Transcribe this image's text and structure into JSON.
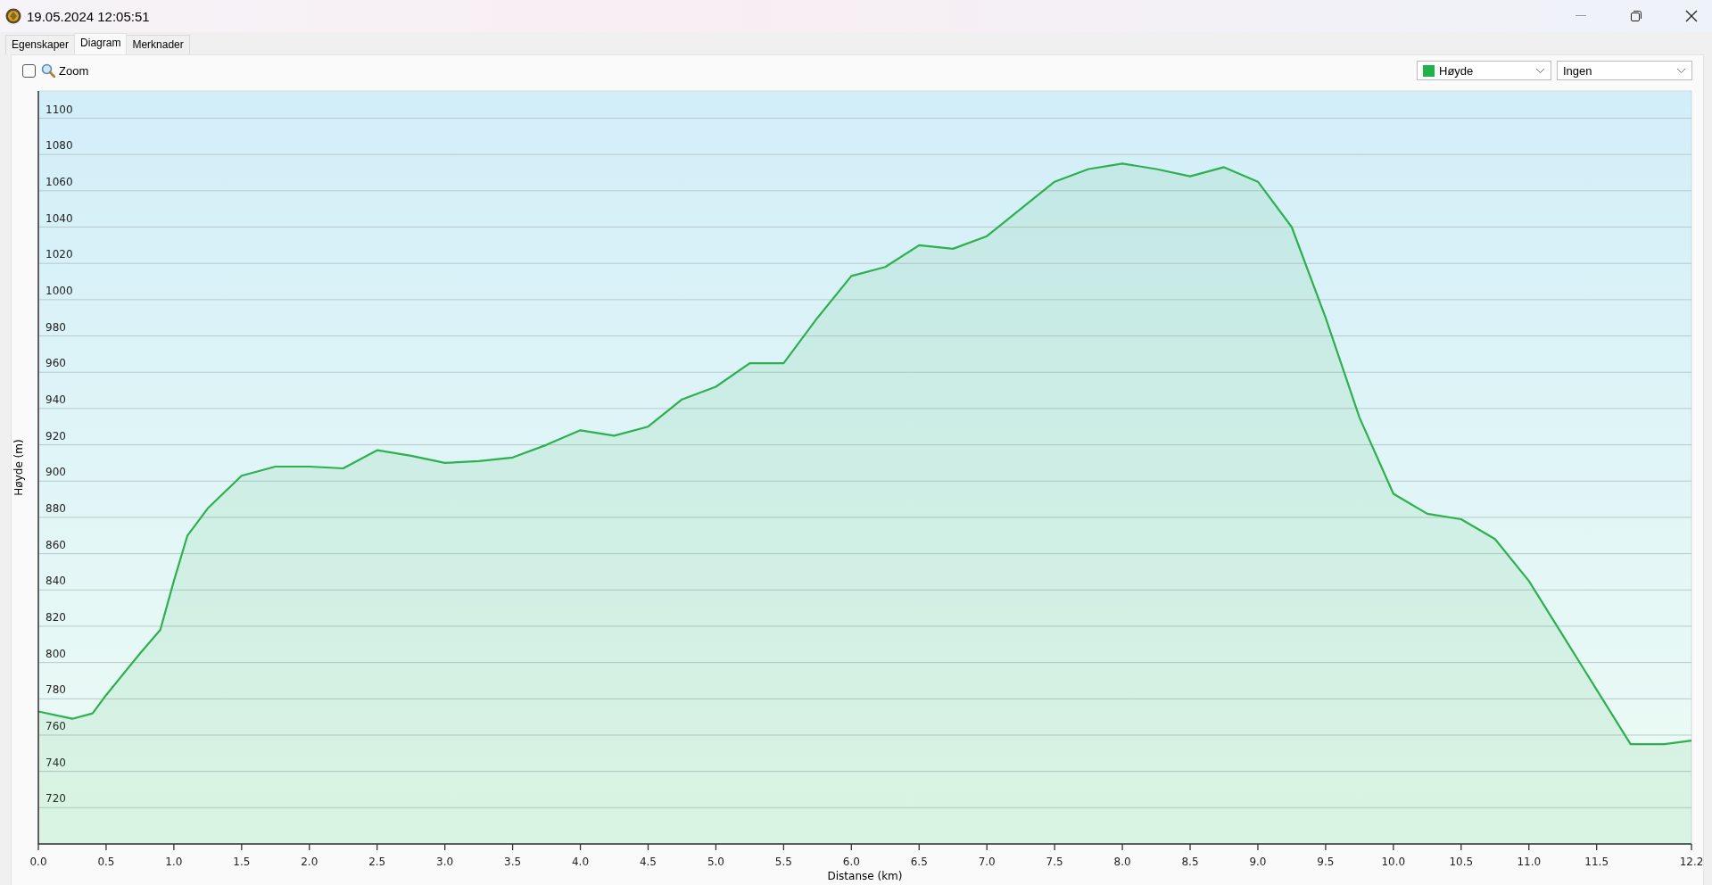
{
  "window": {
    "title": "19.05.2024 12:05:51"
  },
  "tabs": [
    {
      "label": "Egenskaper",
      "selected": false
    },
    {
      "label": "Diagram",
      "selected": true
    },
    {
      "label": "Merknader",
      "selected": false
    }
  ],
  "toolbar": {
    "zoom": {
      "label": "Zoom",
      "checked": false
    },
    "series_select": {
      "color": "#22b14c"
    },
    "secondary_select": {
      "value": "Ingen"
    }
  },
  "chart": {
    "chart_data": {
      "type": "area",
      "xlabel": "Distanse (km)",
      "ylabel": "Høyde (m)",
      "x": [
        0,
        0.25,
        0.4,
        0.5,
        0.75,
        0.9,
        1.0,
        1.1,
        1.25,
        1.5,
        1.75,
        2.0,
        2.25,
        2.5,
        2.75,
        3.0,
        3.25,
        3.5,
        3.75,
        4.0,
        4.25,
        4.5,
        4.75,
        5.0,
        5.25,
        5.5,
        5.75,
        6.0,
        6.25,
        6.5,
        6.75,
        7.0,
        7.25,
        7.5,
        7.75,
        8.0,
        8.25,
        8.5,
        8.75,
        9.0,
        9.25,
        9.5,
        9.75,
        10.0,
        10.25,
        10.5,
        10.75,
        11.0,
        11.25,
        11.5,
        11.75,
        12.0,
        12.2
      ],
      "series": [
        {
          "name": "Høyde",
          "color": "#2db14f",
          "values": [
            773,
            769,
            772,
            782,
            805,
            818,
            845,
            870,
            885,
            903,
            908,
            908,
            907,
            917,
            914,
            910,
            911,
            913,
            920,
            928,
            925,
            930,
            945,
            952,
            965,
            965,
            990,
            1013,
            1018,
            1030,
            1028,
            1035,
            1050,
            1065,
            1072,
            1075,
            1072,
            1068,
            1073,
            1065,
            1040,
            990,
            935,
            893,
            882,
            879,
            868,
            845,
            815,
            785,
            755,
            755,
            757
          ]
        }
      ],
      "grid": true,
      "xlim": [
        0,
        12.2
      ],
      "ylim": [
        700,
        1115
      ],
      "xticks": [
        {
          "value": 0,
          "label": "0.0"
        },
        0.5,
        {
          "value": 1,
          "label": "1.0"
        },
        1.5,
        {
          "value": 2,
          "label": "2.0"
        },
        2.5,
        {
          "value": 3,
          "label": "3.0"
        },
        3.5,
        {
          "value": 4,
          "label": "4.0"
        },
        4.5,
        {
          "value": 5,
          "label": "5.0"
        },
        5.5,
        {
          "value": 6,
          "label": "6.0"
        },
        6.5,
        {
          "value": 7,
          "label": "7.0"
        },
        7.5,
        {
          "value": 8,
          "label": "8.0"
        },
        8.5,
        {
          "value": 9,
          "label": "9.0"
        },
        9.5,
        {
          "value": 10,
          "label": "10.0"
        },
        10.5,
        {
          "value": 11,
          "label": "11.0"
        },
        11.5,
        12.2
      ],
      "yticks": [
        720,
        740,
        760,
        780,
        800,
        820,
        840,
        860,
        880,
        900,
        920,
        940,
        960,
        980,
        1000,
        1020,
        1040,
        1060,
        1080,
        1100
      ]
    }
  }
}
